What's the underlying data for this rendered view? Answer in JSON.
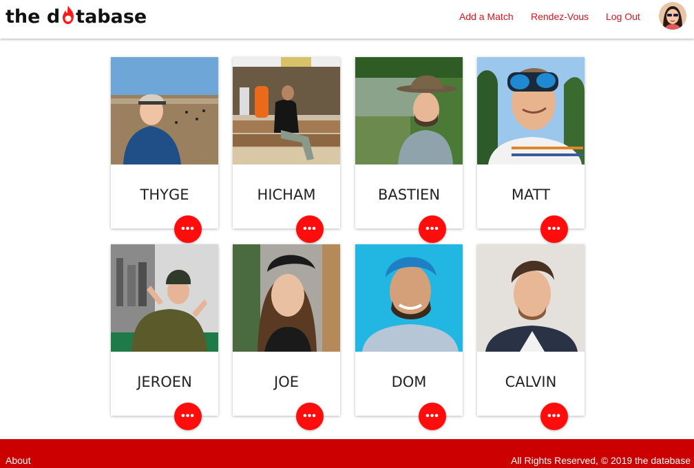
{
  "brand": {
    "logo_prefix": "the d",
    "logo_suffix": "tabase"
  },
  "nav": {
    "add_match": "Add a Match",
    "rendezvous": "Rendez-Vous",
    "logout": "Log Out"
  },
  "colors": {
    "accent": "#e0101a",
    "button": "#ff0d0d",
    "footer": "#cc0000"
  },
  "matches": [
    {
      "name": "THYGE"
    },
    {
      "name": "HICHAM"
    },
    {
      "name": "BASTIEN"
    },
    {
      "name": "MATT"
    },
    {
      "name": "JEROEN"
    },
    {
      "name": "JOE"
    },
    {
      "name": "DOM"
    },
    {
      "name": "CALVIN"
    }
  ],
  "card_action_label": "•••",
  "footer": {
    "about": "About",
    "copyright": "All Rights Reserved, © 2019 the datəbase"
  }
}
